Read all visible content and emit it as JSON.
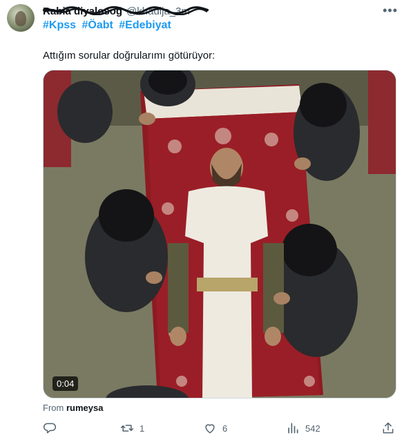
{
  "author": {
    "name": "Rabia diyalosoğ",
    "handle": "@khadija_3m"
  },
  "hashtags": [
    "#Kpss",
    "#Öabt",
    "#Edebiyat"
  ],
  "text": "Attığım sorular doğrularımı götürüyor:",
  "media": {
    "duration": "0:04"
  },
  "source": {
    "prefix": "From",
    "user": "rumeysa"
  },
  "actions": {
    "replies": "",
    "retweets": "1",
    "likes": "6",
    "views": "542"
  },
  "icons": [
    "reply-icon",
    "retweet-icon",
    "like-icon",
    "views-icon",
    "share-icon",
    "more-icon"
  ],
  "colors": {
    "link": "#1d9bf0",
    "muted": "#536471",
    "text": "#0f1419"
  }
}
